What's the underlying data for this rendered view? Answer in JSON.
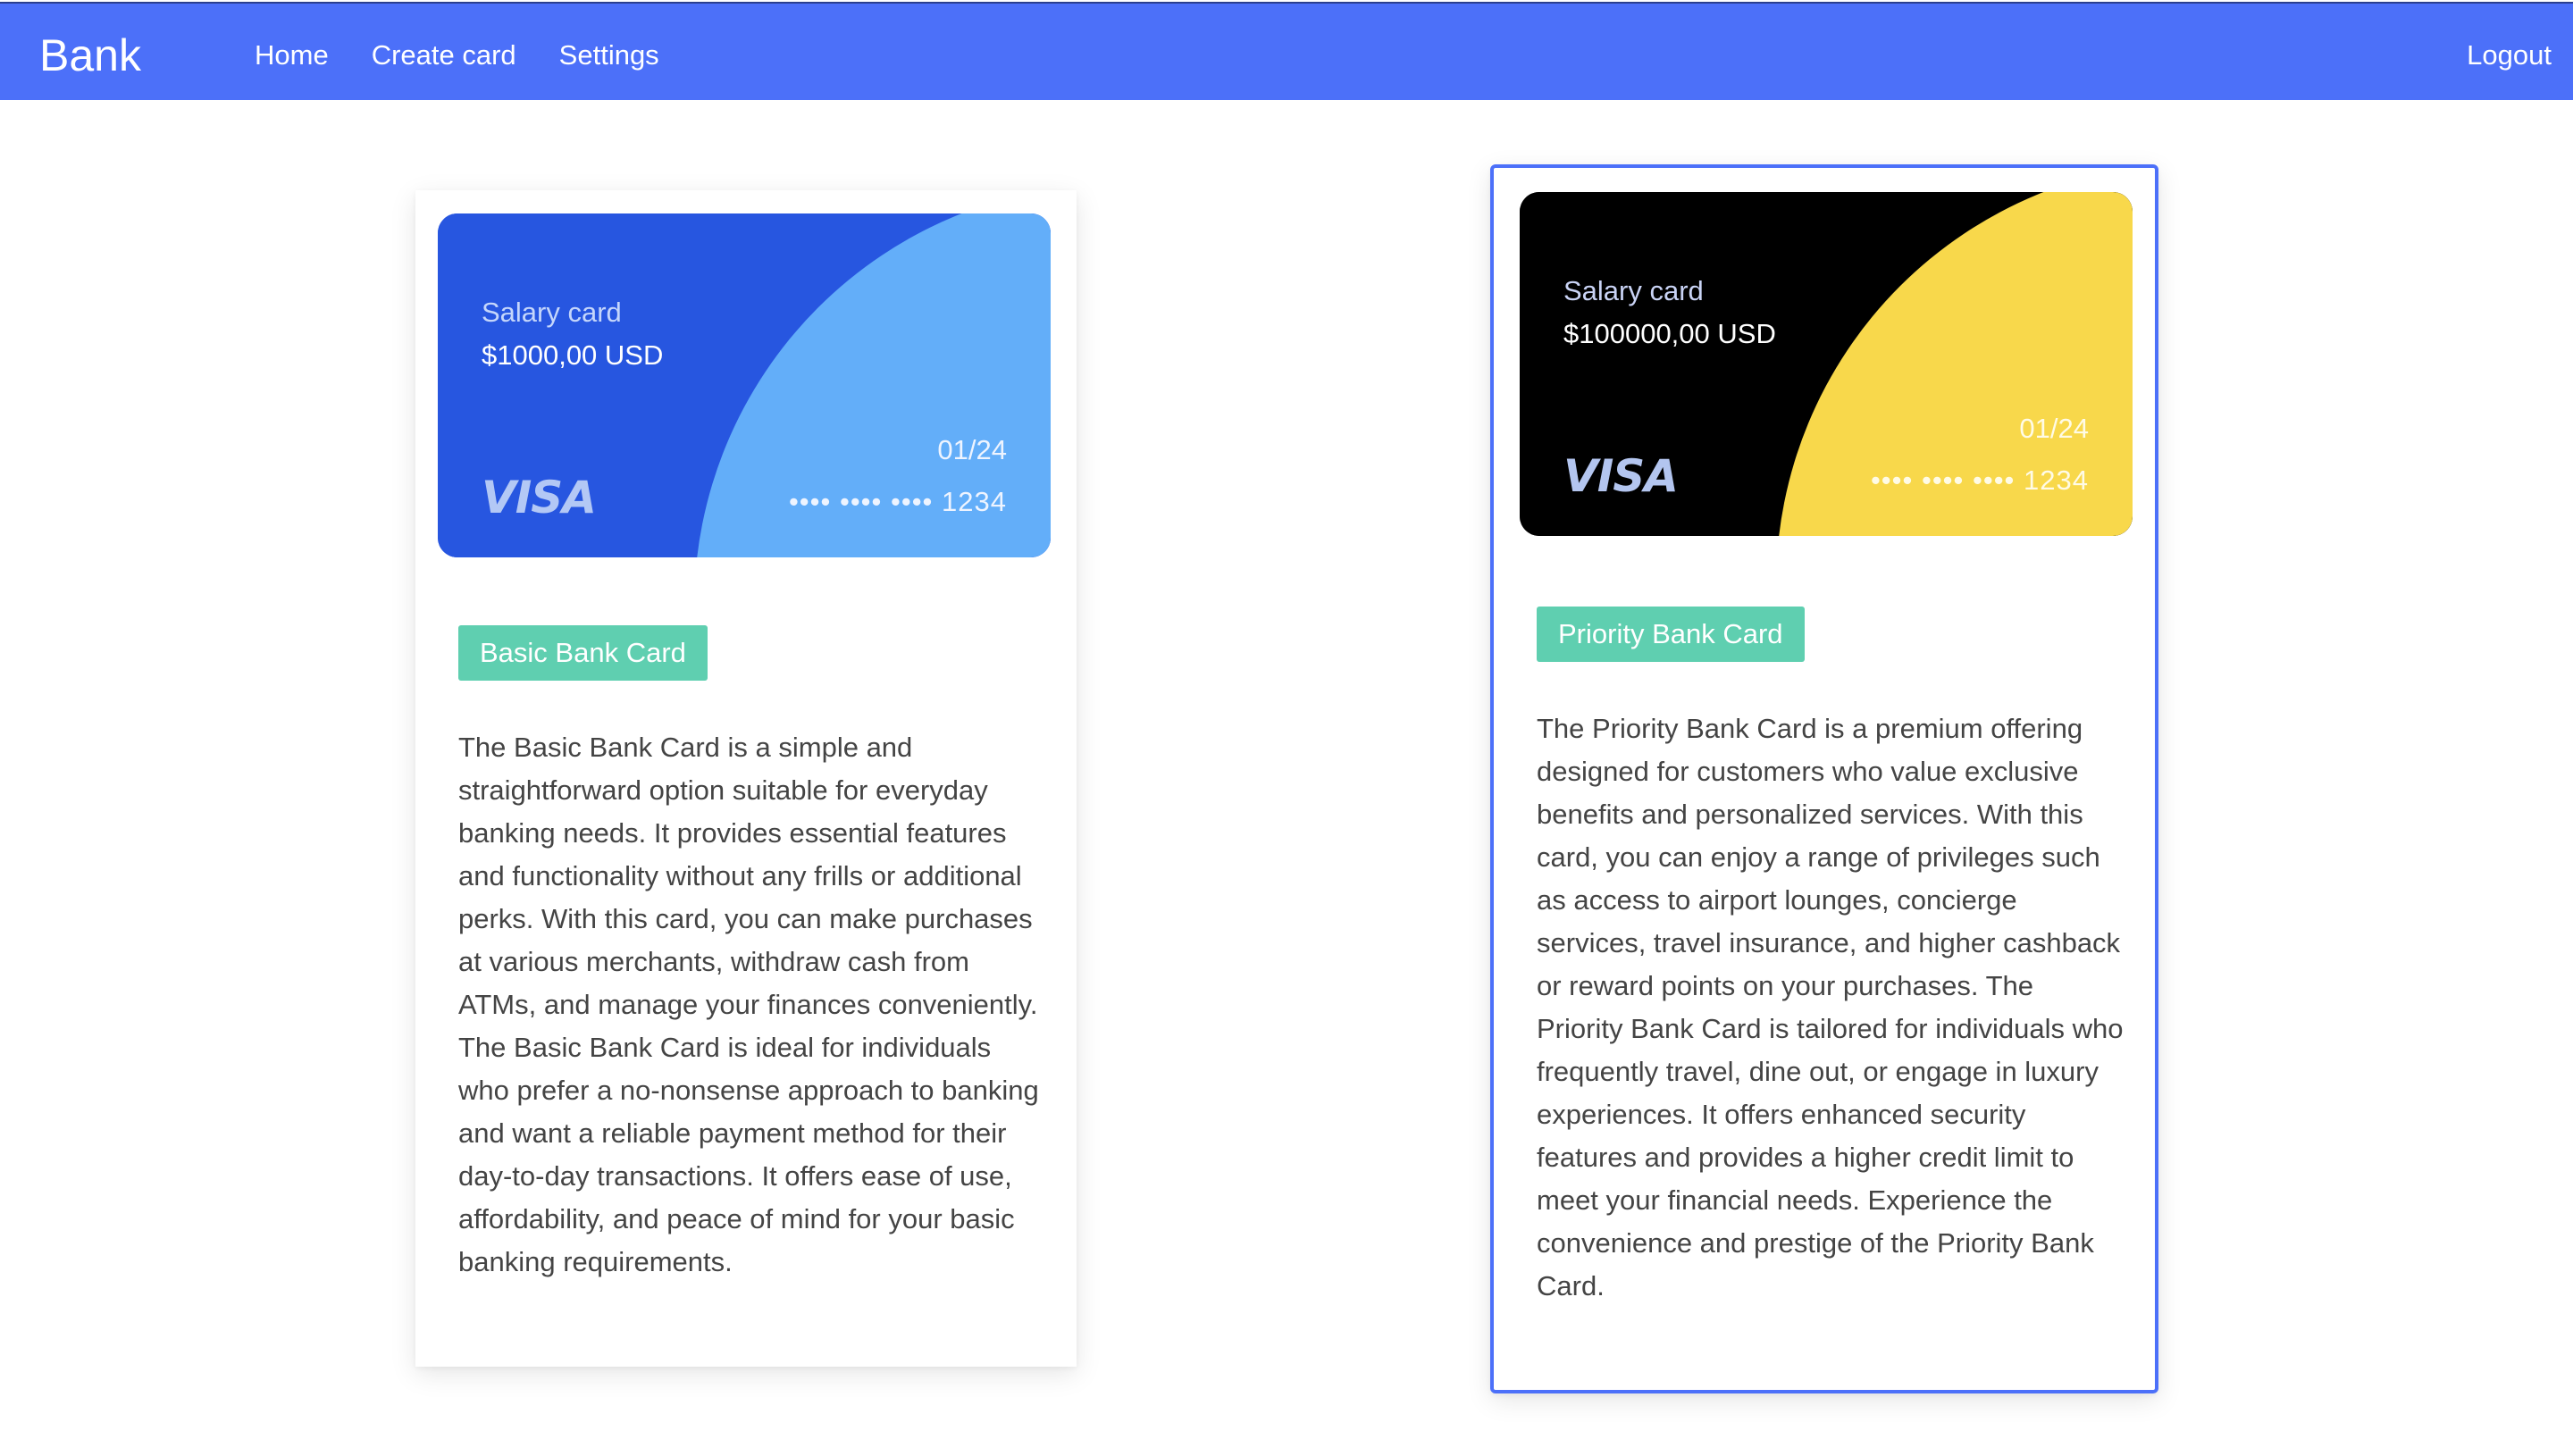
{
  "nav": {
    "brand": "Bank",
    "links": [
      "Home",
      "Create card",
      "Settings"
    ],
    "logout": "Logout"
  },
  "cards": [
    {
      "card_label": "Salary card",
      "amount": "$1000,00 USD",
      "expiry": "01/24",
      "number": "•••• •••• •••• 1234",
      "network": "VISA",
      "tag": "Basic Bank Card",
      "description": "The Basic Bank Card is a simple and straightforward option suitable for everyday banking needs. It provides essential features and functionality without any frills or additional perks. With this card, you can make purchases at various merchants, withdraw cash from ATMs, and manage your finances conveniently. The Basic Bank Card is ideal for individuals who prefer a no-nonsense approach to banking and want a reliable payment method for their day-to-day transactions. It offers ease of use, affordability, and peace of mind for your basic banking requirements.",
      "colors": {
        "base": "#2756e0",
        "accent": "#63aef9"
      }
    },
    {
      "card_label": "Salary card",
      "amount": "$100000,00 USD",
      "expiry": "01/24",
      "number": "•••• •••• •••• 1234",
      "network": "VISA",
      "tag": "Priority Bank Card",
      "description": "The Priority Bank Card is a premium offering designed for customers who value exclusive benefits and personalized services. With this card, you can enjoy a range of privileges such as access to airport lounges, concierge services, travel insurance, and higher cashback or reward points on your purchases. The Priority Bank Card is tailored for individuals who frequently travel, dine out, or engage in luxury experiences. It offers enhanced security features and provides a higher credit limit to meet your financial needs. Experience the convenience and prestige of the Priority Bank Card.",
      "colors": {
        "base": "#000000",
        "accent": "#f8d84b"
      }
    }
  ],
  "colors": {
    "navbar": "#4c70f9",
    "tag": "#5fcfb0",
    "selected_border": "#4c70f9"
  }
}
